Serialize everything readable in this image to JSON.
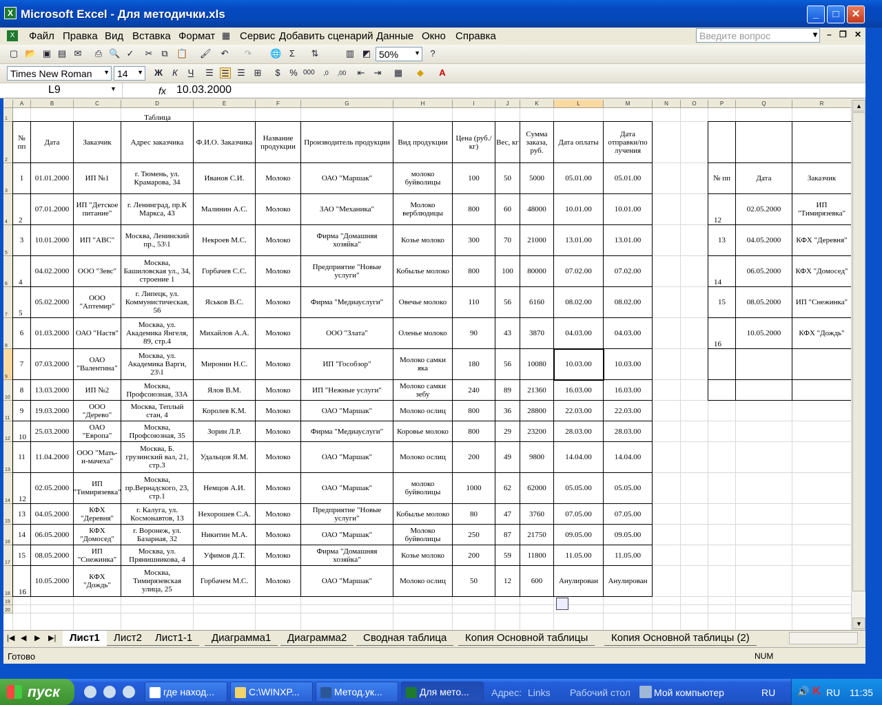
{
  "window": {
    "title": "Microsoft Excel - Для методички.xls"
  },
  "menu": [
    "Файл",
    "Правка",
    "Вид",
    "Вставка",
    "Формат",
    "Сервис",
    "Добавить сценарий",
    "Данные",
    "Окно",
    "Справка"
  ],
  "help_placeholder": "Введите вопрос",
  "toolbar": {
    "zoom": "50%",
    "font": "Times New Roman",
    "size": "14"
  },
  "formula": {
    "cell": "L9",
    "value": "10.03.2000"
  },
  "columns": [
    "A",
    "B",
    "C",
    "D",
    "E",
    "F",
    "G",
    "H",
    "I",
    "J",
    "K",
    "L",
    "M",
    "N",
    "O",
    "P",
    "Q",
    "R"
  ],
  "table_title": "Таблица",
  "headers": [
    "№ пп",
    "Дата",
    "Заказчик",
    "Адрес заказчика",
    "Ф.И.О. Заказчика",
    "Название продукции",
    "Производитель продукции",
    "Вид продукции",
    "Цена (руб./кг)",
    "Вес, кг",
    "Сумма заказа, руб.",
    "Дата оплаты",
    "Дата отправки/по лучения"
  ],
  "rows": [
    [
      "1",
      "01.01.2000",
      "ИП №1",
      "г. Тюмень, ул. Крамарова, 34",
      "Иванов С.И.",
      "Молоко",
      "ОАО \"Маршак\"",
      "молоко буйволицы",
      "100",
      "50",
      "5000",
      "05.01.00",
      "05.01.00"
    ],
    [
      "2",
      "07.01.2000",
      "ИП \"Детское питание\"",
      "г. Ленинград, пр.К Маркса, 43",
      "Малинин А.С.",
      "Молоко",
      "ЗАО \"Механика\"",
      "Молоко верблюдицы",
      "800",
      "60",
      "48000",
      "10.01.00",
      "10.01.00"
    ],
    [
      "3",
      "10.01.2000",
      "ИП \"АВС\"",
      "Москва, Ленинский пр., 53\\1",
      "Некроев М.С.",
      "Молоко",
      "Фирма \"Домашняя хозяйка\"",
      "Козье молоко",
      "300",
      "70",
      "21000",
      "13.01.00",
      "13.01.00"
    ],
    [
      "4",
      "04.02.2000",
      "ООО \"Зевс\"",
      "Москва, Башиловская ул., 34, строение 1",
      "Горбачев С.С.",
      "Молоко",
      "Предприятие \"Новые услуги\"",
      "Кобылье молоко",
      "800",
      "100",
      "80000",
      "07.02.00",
      "07.02.00"
    ],
    [
      "5",
      "05.02.2000",
      "ООО \"Аптемир\"",
      "г. Липецк, ул. Коммунистическая, 56",
      "Яськов В.С.",
      "Молоко",
      "Фирма \"Медиауслуги\"",
      "Овечье молоко",
      "110",
      "56",
      "6160",
      "08.02.00",
      "08.02.00"
    ],
    [
      "6",
      "01.03.2000",
      "ОАО \"Настя\"",
      "Москва, ул. Академика Янгеля, 89, стр.4",
      "Михайлов А.А.",
      "Молоко",
      "ООО \"Злата\"",
      "Оленье молоко",
      "90",
      "43",
      "3870",
      "04.03.00",
      "04.03.00"
    ],
    [
      "7",
      "07.03.2000",
      "ОАО \"Валентина\"",
      "Москва, ул. Академика Варги, 23\\1",
      "Миронин Н.С.",
      "Молоко",
      "ИП \"Гособзор\"",
      "Молоко самки яка",
      "180",
      "56",
      "10080",
      "10.03.00",
      "10.03.00"
    ],
    [
      "8",
      "13.03.2000",
      "ИП №2",
      "Москва, Профсоюзная, 33А",
      "Ялов В.М.",
      "Молоко",
      "ИП \"Нежные услуги\"",
      "Молоко самки зебу",
      "240",
      "89",
      "21360",
      "16.03.00",
      "16.03.00"
    ],
    [
      "9",
      "19.03.2000",
      "ООО \"Дерево\"",
      "Москва, Теплый стан, 4",
      "Королев К.М.",
      "Молоко",
      "ОАО \"Маршак\"",
      "Молоко ослиц",
      "800",
      "36",
      "28800",
      "22.03.00",
      "22.03.00"
    ],
    [
      "10",
      "25.03.2000",
      "ОАО \"Европа\"",
      "Москва, Профсоюзная, 35",
      "Зорин Л.Р.",
      "Молоко",
      "Фирма \"Медиауслуги\"",
      "Коровье молоко",
      "800",
      "29",
      "23200",
      "28.03.00",
      "28.03.00"
    ],
    [
      "11",
      "11.04.2000",
      "ООО \"Мать-и-мачеха\"",
      "Москва, Б. грузинский вал, 21, стр.3",
      "Удальцов Я.М.",
      "Молоко",
      "ОАО \"Маршак\"",
      "Молоко ослиц",
      "200",
      "49",
      "9800",
      "14.04.00",
      "14.04.00"
    ],
    [
      "12",
      "02.05.2000",
      "ИП \"Тимирязевка\"",
      "Москва, пр.Вернадского, 23, стр.1",
      "Немцов А.И.",
      "Молоко",
      "ОАО \"Маршак\"",
      "молоко буйволицы",
      "1000",
      "62",
      "62000",
      "05.05.00",
      "05.05.00"
    ],
    [
      "13",
      "04.05.2000",
      "КФХ \"Деревня\"",
      "г. Калуга, ул. Космонавтов, 13",
      "Нехорошев С.А.",
      "Молоко",
      "Предприятие \"Новые услуги\"",
      "Кобылье молоко",
      "80",
      "47",
      "3760",
      "07.05.00",
      "07.05.00"
    ],
    [
      "14",
      "06.05.2000",
      "КФХ \"Домосед\"",
      "г. Воронеж, ул. Базарная, 32",
      "Никитин М.А.",
      "Молоко",
      "ОАО \"Маршак\"",
      "Молоко буйволицы",
      "250",
      "87",
      "21750",
      "09.05.00",
      "09.05.00"
    ],
    [
      "15",
      "08.05.2000",
      "ИП \"Снежинка\"",
      "Москва, ул. Прянишникова, 4",
      "Уфимов Д.Т.",
      "Молоко",
      "Фирма \"Домашняя хозяйка\"",
      "Козье молоко",
      "200",
      "59",
      "11800",
      "11.05.00",
      "11.05.00"
    ],
    [
      "16",
      "10.05.2000",
      "КФХ \"Дождь\"",
      "Москва, Тимирязевская улица, 25",
      "Горбачем М.С.",
      "Молоко",
      "ОАО \"Маршак\"",
      "Молоко ослиц",
      "50",
      "12",
      "600",
      "Анулирован",
      "Анулирован"
    ]
  ],
  "side_headers": [
    "№ пп",
    "Дата",
    "Заказчик"
  ],
  "side_rows": [
    [
      "12",
      "02.05.2000",
      "ИП \"Тимирязевка\""
    ],
    [
      "13",
      "04.05.2000",
      "КФХ \"Деревня\""
    ],
    [
      "14",
      "06.05.2000",
      "КФХ \"Домосед\""
    ],
    [
      "15",
      "08.05.2000",
      "ИП \"Снежинка\""
    ],
    [
      "16",
      "10.05.2000",
      "КФХ \"Дождь\""
    ]
  ],
  "sheets": [
    "Лист1",
    "Лист2",
    "Лист1-1",
    "Диаграмма1",
    "Диаграмма2",
    "Сводная таблица",
    "Копия Основной таблицы",
    "Копия Основной таблицы (2)"
  ],
  "status": {
    "ready": "Готово",
    "num": "NUM"
  },
  "taskbar": {
    "start": "пуск",
    "buttons": [
      "где наход...",
      "C:\\WINXP...",
      "Метод.ук...",
      "Для мето..."
    ],
    "address_label": "Адрес:",
    "links": "Links",
    "desktop": "Рабочий стол",
    "mycomputer": "Мой компьютер",
    "lang": "RU",
    "lang2": "RU",
    "clock": "11:35"
  }
}
